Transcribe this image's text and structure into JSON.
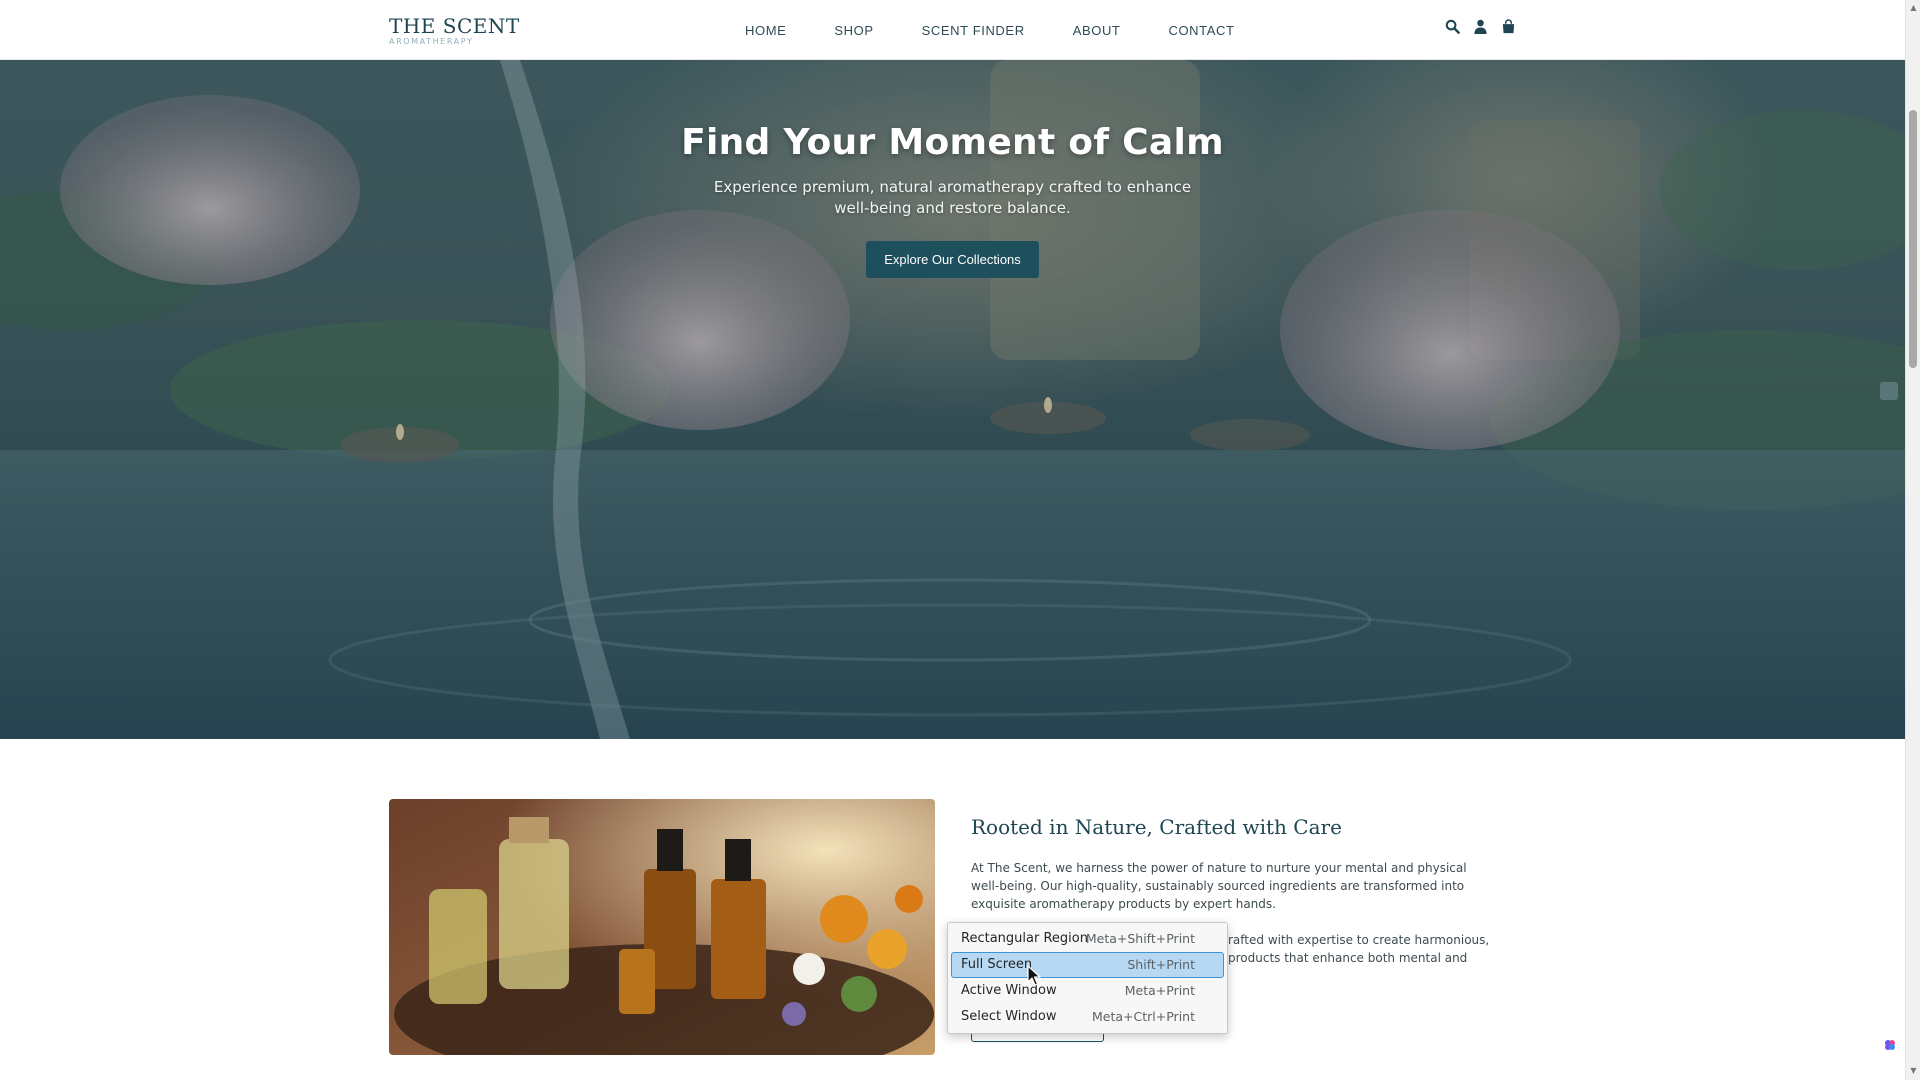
{
  "brand": {
    "name": "THE SCENT",
    "tagline": "AROMATHERAPY",
    "primary_color": "#1e4f5c"
  },
  "nav": {
    "items": [
      {
        "label": "HOME"
      },
      {
        "label": "SHOP"
      },
      {
        "label": "SCENT FINDER"
      },
      {
        "label": "ABOUT"
      },
      {
        "label": "CONTACT"
      }
    ],
    "icons": [
      "search-icon",
      "user-icon",
      "shopping-bag-icon"
    ]
  },
  "hero": {
    "title": "Find Your Moment of Calm",
    "subtitle": "Experience premium, natural aromatherapy crafted to enhance well-being and restore balance.",
    "cta_label": "Explore Our Collections"
  },
  "about": {
    "title": "Rooted in Nature, Crafted with Care",
    "paragraph1": "At The Scent, we harness the power of nature to nurture your mental and physical well-being. Our high-quality, sustainably sourced ingredients are transformed into exquisite aromatherapy products by expert hands.",
    "paragraph2_fragment1": "rafted with expertise to create harmonious,",
    "paragraph2_fragment2": "products that enhance both mental and"
  },
  "context_menu": {
    "items": [
      {
        "label": "Rectangular Region",
        "shortcut": "Meta+Shift+Print",
        "active": false
      },
      {
        "label": "Full Screen",
        "shortcut": "Shift+Print",
        "active": true
      },
      {
        "label": "Active Window",
        "shortcut": "Meta+Print",
        "active": false
      },
      {
        "label": "Select Window",
        "shortcut": "Meta+Ctrl+Print",
        "active": false
      }
    ],
    "highlight_color": "#b6d8f2"
  }
}
